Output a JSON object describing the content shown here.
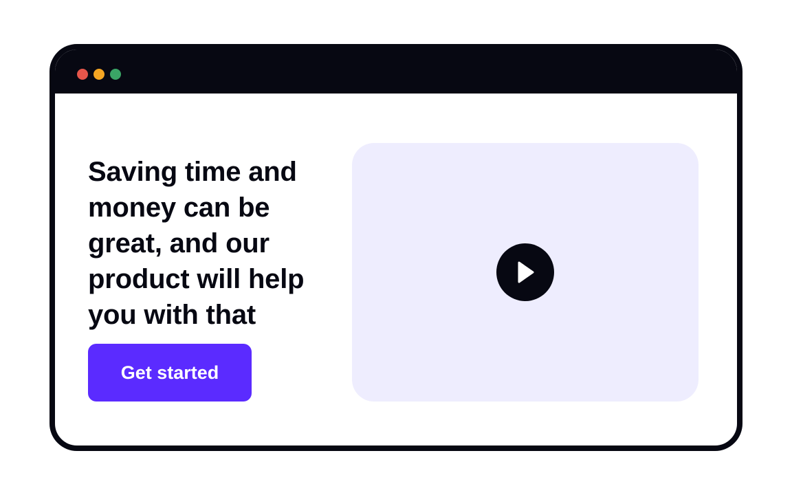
{
  "window": {
    "controls": [
      {
        "name": "close",
        "color": "#E5564B"
      },
      {
        "name": "minimize",
        "color": "#F5A623"
      },
      {
        "name": "maximize",
        "color": "#3AA566"
      }
    ]
  },
  "hero": {
    "headline": "Saving time and money can be great, and our product will help you with that",
    "cta_label": "Get started"
  },
  "video": {
    "play_icon": "play-icon"
  },
  "colors": {
    "frame": "#070812",
    "accent": "#5B2BFF",
    "video_background": "#EEEDFE",
    "play_button": "#070812"
  }
}
